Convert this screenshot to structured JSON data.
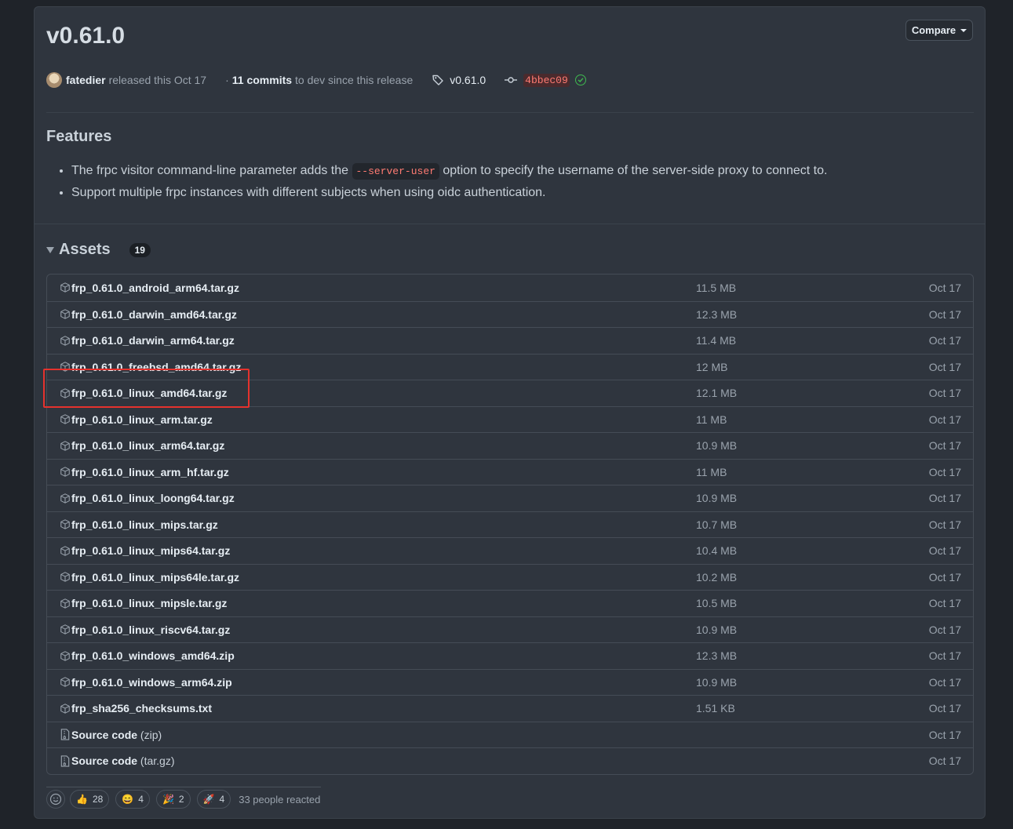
{
  "release": {
    "title": "v0.61.0",
    "compare_label": "Compare",
    "author": "fatedier",
    "released_text": "released this Oct 17",
    "commits_prefix": "·",
    "commits_count": "11 commits",
    "commits_suffix": "to dev since this release",
    "tag": "v0.61.0",
    "commit_sha": "4bbec09"
  },
  "features": {
    "heading": "Features",
    "item1_before": "The frpc visitor command-line parameter adds the",
    "item1_code": "--server-user",
    "item1_after": "option to specify the username of the server-side proxy to connect to.",
    "item2": "Support multiple frpc instances with different subjects when using oidc authentication."
  },
  "assets": {
    "heading": "Assets",
    "count": "19",
    "rows": [
      {
        "name": "frp_0.61.0_android_arm64.tar.gz",
        "size": "11.5 MB",
        "date": "Oct 17"
      },
      {
        "name": "frp_0.61.0_darwin_amd64.tar.gz",
        "size": "12.3 MB",
        "date": "Oct 17"
      },
      {
        "name": "frp_0.61.0_darwin_arm64.tar.gz",
        "size": "11.4 MB",
        "date": "Oct 17"
      },
      {
        "name": "frp_0.61.0_freebsd_amd64.tar.gz",
        "size": "12 MB",
        "date": "Oct 17"
      },
      {
        "name": "frp_0.61.0_linux_amd64.tar.gz",
        "size": "12.1 MB",
        "date": "Oct 17"
      },
      {
        "name": "frp_0.61.0_linux_arm.tar.gz",
        "size": "11 MB",
        "date": "Oct 17"
      },
      {
        "name": "frp_0.61.0_linux_arm64.tar.gz",
        "size": "10.9 MB",
        "date": "Oct 17"
      },
      {
        "name": "frp_0.61.0_linux_arm_hf.tar.gz",
        "size": "11 MB",
        "date": "Oct 17"
      },
      {
        "name": "frp_0.61.0_linux_loong64.tar.gz",
        "size": "10.9 MB",
        "date": "Oct 17"
      },
      {
        "name": "frp_0.61.0_linux_mips.tar.gz",
        "size": "10.7 MB",
        "date": "Oct 17"
      },
      {
        "name": "frp_0.61.0_linux_mips64.tar.gz",
        "size": "10.4 MB",
        "date": "Oct 17"
      },
      {
        "name": "frp_0.61.0_linux_mips64le.tar.gz",
        "size": "10.2 MB",
        "date": "Oct 17"
      },
      {
        "name": "frp_0.61.0_linux_mipsle.tar.gz",
        "size": "10.5 MB",
        "date": "Oct 17"
      },
      {
        "name": "frp_0.61.0_linux_riscv64.tar.gz",
        "size": "10.9 MB",
        "date": "Oct 17"
      },
      {
        "name": "frp_0.61.0_windows_amd64.zip",
        "size": "12.3 MB",
        "date": "Oct 17"
      },
      {
        "name": "frp_0.61.0_windows_arm64.zip",
        "size": "10.9 MB",
        "date": "Oct 17"
      },
      {
        "name": "frp_sha256_checksums.txt",
        "size": "1.51 KB",
        "date": "Oct 17"
      }
    ],
    "source_rows": [
      {
        "name": "Source code",
        "ext": "(zip)",
        "date": "Oct 17"
      },
      {
        "name": "Source code",
        "ext": "(tar.gz)",
        "date": "Oct 17"
      }
    ]
  },
  "reactions": {
    "items": [
      {
        "emoji": "👍",
        "count": "28"
      },
      {
        "emoji": "😄",
        "count": "4"
      },
      {
        "emoji": "🎉",
        "count": "2"
      },
      {
        "emoji": "🚀",
        "count": "4"
      }
    ],
    "summary": "33 people reacted"
  }
}
